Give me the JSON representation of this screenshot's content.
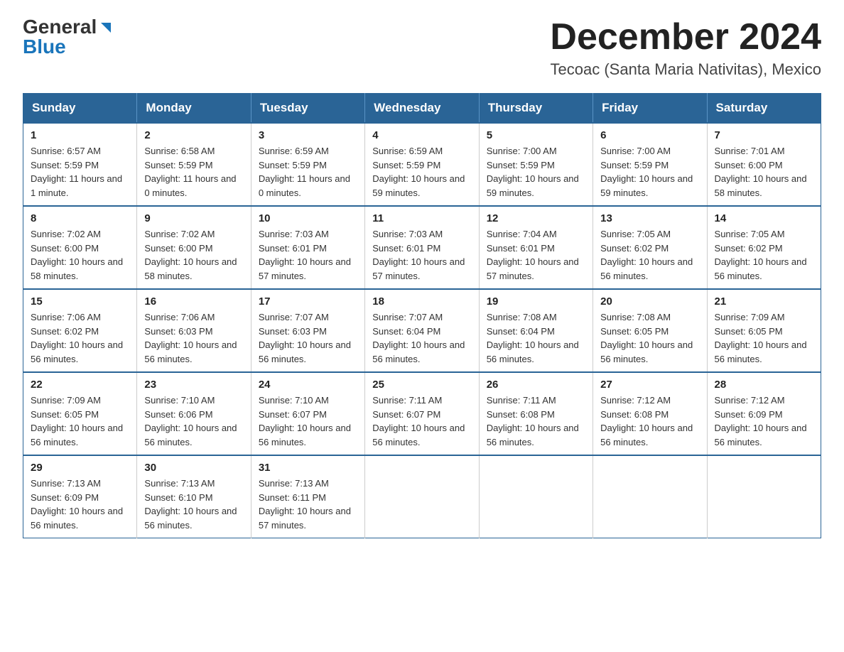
{
  "logo": {
    "general": "General",
    "blue": "Blue",
    "triangle": "▶"
  },
  "header": {
    "month": "December 2024",
    "location": "Tecoac (Santa Maria Nativitas), Mexico"
  },
  "weekdays": [
    "Sunday",
    "Monday",
    "Tuesday",
    "Wednesday",
    "Thursday",
    "Friday",
    "Saturday"
  ],
  "weeks": [
    [
      {
        "day": "1",
        "sunrise": "Sunrise: 6:57 AM",
        "sunset": "Sunset: 5:59 PM",
        "daylight": "Daylight: 11 hours and 1 minute."
      },
      {
        "day": "2",
        "sunrise": "Sunrise: 6:58 AM",
        "sunset": "Sunset: 5:59 PM",
        "daylight": "Daylight: 11 hours and 0 minutes."
      },
      {
        "day": "3",
        "sunrise": "Sunrise: 6:59 AM",
        "sunset": "Sunset: 5:59 PM",
        "daylight": "Daylight: 11 hours and 0 minutes."
      },
      {
        "day": "4",
        "sunrise": "Sunrise: 6:59 AM",
        "sunset": "Sunset: 5:59 PM",
        "daylight": "Daylight: 10 hours and 59 minutes."
      },
      {
        "day": "5",
        "sunrise": "Sunrise: 7:00 AM",
        "sunset": "Sunset: 5:59 PM",
        "daylight": "Daylight: 10 hours and 59 minutes."
      },
      {
        "day": "6",
        "sunrise": "Sunrise: 7:00 AM",
        "sunset": "Sunset: 5:59 PM",
        "daylight": "Daylight: 10 hours and 59 minutes."
      },
      {
        "day": "7",
        "sunrise": "Sunrise: 7:01 AM",
        "sunset": "Sunset: 6:00 PM",
        "daylight": "Daylight: 10 hours and 58 minutes."
      }
    ],
    [
      {
        "day": "8",
        "sunrise": "Sunrise: 7:02 AM",
        "sunset": "Sunset: 6:00 PM",
        "daylight": "Daylight: 10 hours and 58 minutes."
      },
      {
        "day": "9",
        "sunrise": "Sunrise: 7:02 AM",
        "sunset": "Sunset: 6:00 PM",
        "daylight": "Daylight: 10 hours and 58 minutes."
      },
      {
        "day": "10",
        "sunrise": "Sunrise: 7:03 AM",
        "sunset": "Sunset: 6:01 PM",
        "daylight": "Daylight: 10 hours and 57 minutes."
      },
      {
        "day": "11",
        "sunrise": "Sunrise: 7:03 AM",
        "sunset": "Sunset: 6:01 PM",
        "daylight": "Daylight: 10 hours and 57 minutes."
      },
      {
        "day": "12",
        "sunrise": "Sunrise: 7:04 AM",
        "sunset": "Sunset: 6:01 PM",
        "daylight": "Daylight: 10 hours and 57 minutes."
      },
      {
        "day": "13",
        "sunrise": "Sunrise: 7:05 AM",
        "sunset": "Sunset: 6:02 PM",
        "daylight": "Daylight: 10 hours and 56 minutes."
      },
      {
        "day": "14",
        "sunrise": "Sunrise: 7:05 AM",
        "sunset": "Sunset: 6:02 PM",
        "daylight": "Daylight: 10 hours and 56 minutes."
      }
    ],
    [
      {
        "day": "15",
        "sunrise": "Sunrise: 7:06 AM",
        "sunset": "Sunset: 6:02 PM",
        "daylight": "Daylight: 10 hours and 56 minutes."
      },
      {
        "day": "16",
        "sunrise": "Sunrise: 7:06 AM",
        "sunset": "Sunset: 6:03 PM",
        "daylight": "Daylight: 10 hours and 56 minutes."
      },
      {
        "day": "17",
        "sunrise": "Sunrise: 7:07 AM",
        "sunset": "Sunset: 6:03 PM",
        "daylight": "Daylight: 10 hours and 56 minutes."
      },
      {
        "day": "18",
        "sunrise": "Sunrise: 7:07 AM",
        "sunset": "Sunset: 6:04 PM",
        "daylight": "Daylight: 10 hours and 56 minutes."
      },
      {
        "day": "19",
        "sunrise": "Sunrise: 7:08 AM",
        "sunset": "Sunset: 6:04 PM",
        "daylight": "Daylight: 10 hours and 56 minutes."
      },
      {
        "day": "20",
        "sunrise": "Sunrise: 7:08 AM",
        "sunset": "Sunset: 6:05 PM",
        "daylight": "Daylight: 10 hours and 56 minutes."
      },
      {
        "day": "21",
        "sunrise": "Sunrise: 7:09 AM",
        "sunset": "Sunset: 6:05 PM",
        "daylight": "Daylight: 10 hours and 56 minutes."
      }
    ],
    [
      {
        "day": "22",
        "sunrise": "Sunrise: 7:09 AM",
        "sunset": "Sunset: 6:05 PM",
        "daylight": "Daylight: 10 hours and 56 minutes."
      },
      {
        "day": "23",
        "sunrise": "Sunrise: 7:10 AM",
        "sunset": "Sunset: 6:06 PM",
        "daylight": "Daylight: 10 hours and 56 minutes."
      },
      {
        "day": "24",
        "sunrise": "Sunrise: 7:10 AM",
        "sunset": "Sunset: 6:07 PM",
        "daylight": "Daylight: 10 hours and 56 minutes."
      },
      {
        "day": "25",
        "sunrise": "Sunrise: 7:11 AM",
        "sunset": "Sunset: 6:07 PM",
        "daylight": "Daylight: 10 hours and 56 minutes."
      },
      {
        "day": "26",
        "sunrise": "Sunrise: 7:11 AM",
        "sunset": "Sunset: 6:08 PM",
        "daylight": "Daylight: 10 hours and 56 minutes."
      },
      {
        "day": "27",
        "sunrise": "Sunrise: 7:12 AM",
        "sunset": "Sunset: 6:08 PM",
        "daylight": "Daylight: 10 hours and 56 minutes."
      },
      {
        "day": "28",
        "sunrise": "Sunrise: 7:12 AM",
        "sunset": "Sunset: 6:09 PM",
        "daylight": "Daylight: 10 hours and 56 minutes."
      }
    ],
    [
      {
        "day": "29",
        "sunrise": "Sunrise: 7:13 AM",
        "sunset": "Sunset: 6:09 PM",
        "daylight": "Daylight: 10 hours and 56 minutes."
      },
      {
        "day": "30",
        "sunrise": "Sunrise: 7:13 AM",
        "sunset": "Sunset: 6:10 PM",
        "daylight": "Daylight: 10 hours and 56 minutes."
      },
      {
        "day": "31",
        "sunrise": "Sunrise: 7:13 AM",
        "sunset": "Sunset: 6:11 PM",
        "daylight": "Daylight: 10 hours and 57 minutes."
      },
      null,
      null,
      null,
      null
    ]
  ]
}
